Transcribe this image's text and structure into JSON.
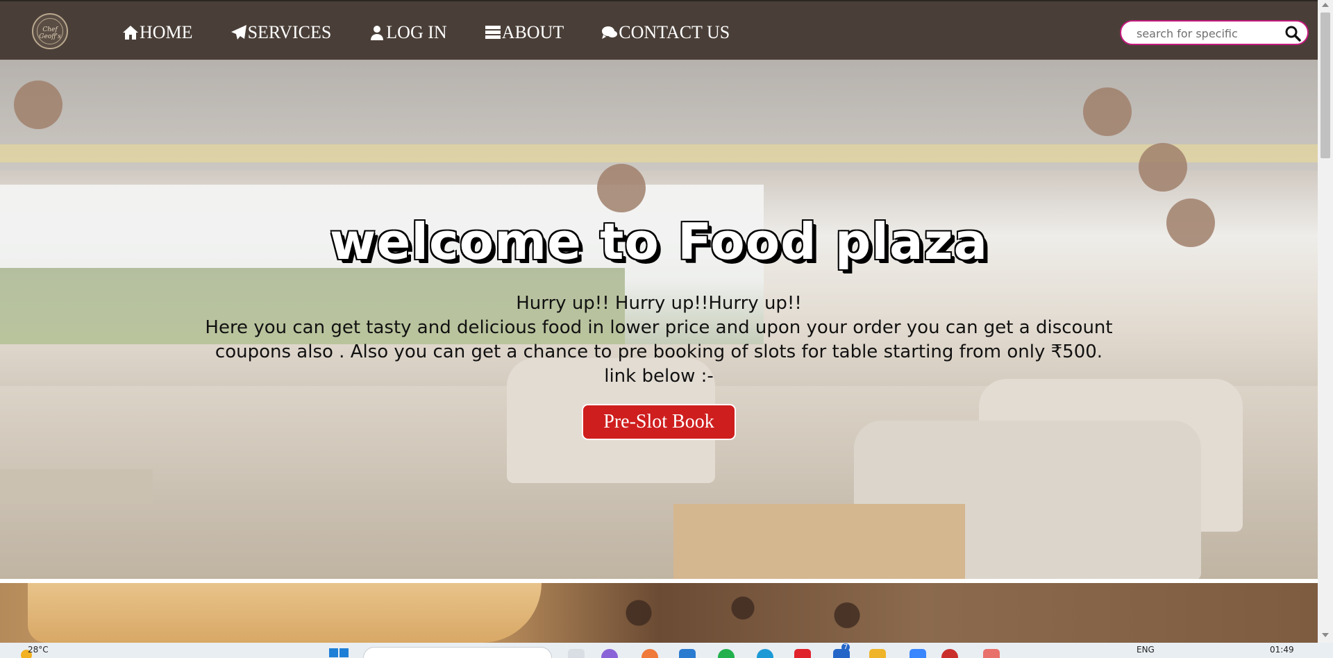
{
  "logo": {
    "text": "Chef Geoff's"
  },
  "nav": {
    "items": [
      {
        "label": "HOME",
        "icon": "home-icon"
      },
      {
        "label": "SERVICES",
        "icon": "paper-plane-icon"
      },
      {
        "label": "LOG IN",
        "icon": "user-icon"
      },
      {
        "label": "ABOUT",
        "icon": "server-list-icon"
      },
      {
        "label": "CONTACT US",
        "icon": "comments-icon"
      }
    ]
  },
  "search": {
    "placeholder": "search for specific",
    "value": ""
  },
  "hero": {
    "title": "welcome to Food plaza",
    "line1": "Hurry up!! Hurry up!!Hurry up!!",
    "line2": "Here you can get tasty and delicious food in lower price and upon your order you can get a discount coupons also . Also you can get a chance to pre booking of slots for table starting from only ₹500.",
    "line3": "link below :-",
    "button_label": "Pre-Slot Book"
  },
  "taskbar": {
    "temperature": "28°C",
    "language": "ENG",
    "time": "01:49",
    "badge": "7"
  },
  "colors": {
    "navbar": "#4a3f38",
    "search_border": "#c51a7e",
    "button": "#cf1e1e"
  }
}
